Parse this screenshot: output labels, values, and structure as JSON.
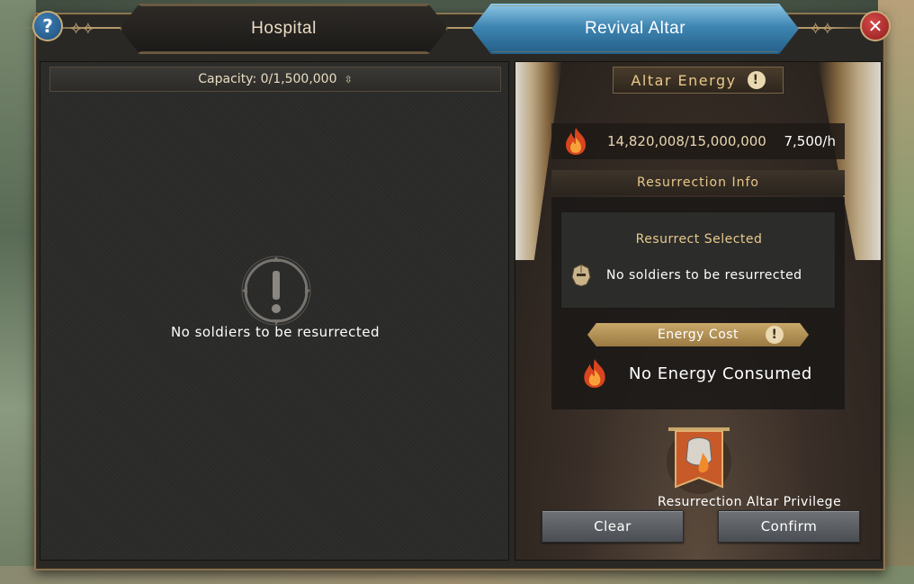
{
  "tabs": {
    "hospital": "Hospital",
    "revival_altar": "Revival Altar"
  },
  "top_buttons": {
    "help": "?",
    "close": "✕"
  },
  "left": {
    "capacity": "Capacity: 0/1,500,000",
    "empty_message": "No soldiers to be resurrected"
  },
  "right": {
    "altar_energy_title": "Altar Energy",
    "energy_value": "14,820,008/15,000,000",
    "energy_rate": "7,500/h",
    "resurrection_info_title": "Resurrection Info",
    "resurrect_selected_title": "Resurrect Selected",
    "resurrect_selected_empty": "No soldiers to be resurrected",
    "energy_cost_title": "Energy Cost",
    "energy_cost_value": "No Energy Consumed",
    "privilege_label": "Resurrection Altar Privilege",
    "clear_button": "Clear",
    "confirm_button": "Confirm"
  },
  "icons": [
    "help-icon",
    "close-icon",
    "sort-icon",
    "warning-icon",
    "fire-icon",
    "helmet-icon",
    "info-icon",
    "privilege-banner-icon"
  ],
  "colors": {
    "accent_blue": "#3f86b3",
    "gold_text": "#e8c98a",
    "close_red": "#c23a3a"
  }
}
